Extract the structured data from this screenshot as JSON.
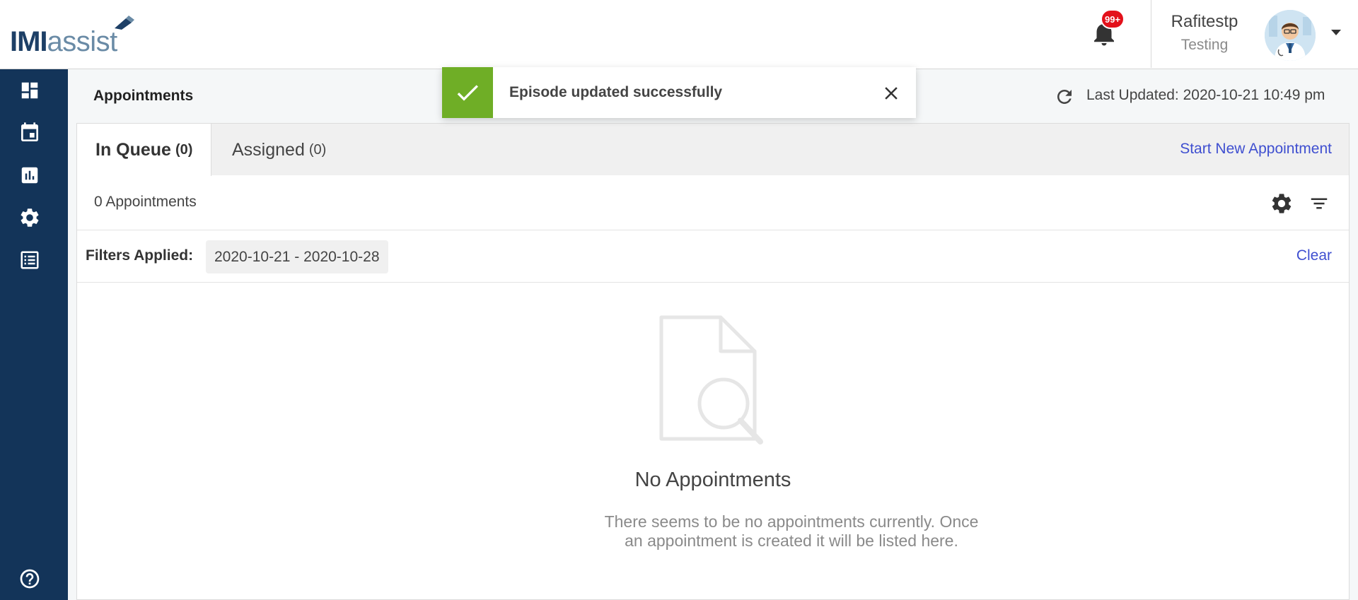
{
  "header": {
    "logo_primary": "IMI",
    "logo_secondary": "assist",
    "notification_badge": "99+",
    "user_name": "Rafitestp",
    "user_role": "Testing"
  },
  "sidebar": {
    "items": [
      {
        "icon": "dashboard-icon"
      },
      {
        "icon": "calendar-icon"
      },
      {
        "icon": "reports-icon"
      },
      {
        "icon": "settings-icon"
      },
      {
        "icon": "list-icon"
      },
      {
        "icon": "help-icon"
      }
    ]
  },
  "page": {
    "title": "Appointments",
    "last_updated": "Last Updated: 2020-10-21 10:49 pm"
  },
  "toast": {
    "message": "Episode updated successfully"
  },
  "tabs": [
    {
      "label": "In Queue",
      "count": "(0)",
      "active": true
    },
    {
      "label": "Assigned",
      "count": "(0)",
      "active": false
    }
  ],
  "actions": {
    "start_new": "Start New Appointment",
    "clear": "Clear"
  },
  "list": {
    "count_text": "0 Appointments",
    "filters_label": "Filters Applied:",
    "filter_chip": "2020-10-21 - 2020-10-28"
  },
  "empty_state": {
    "title": "No Appointments",
    "description": "There seems to be no appointments currently. Once an appointment is created it will be listed here."
  },
  "colors": {
    "sidebar": "#133459",
    "link": "#3f4fd0",
    "success": "#6fae26",
    "badge": "#e3111b"
  }
}
